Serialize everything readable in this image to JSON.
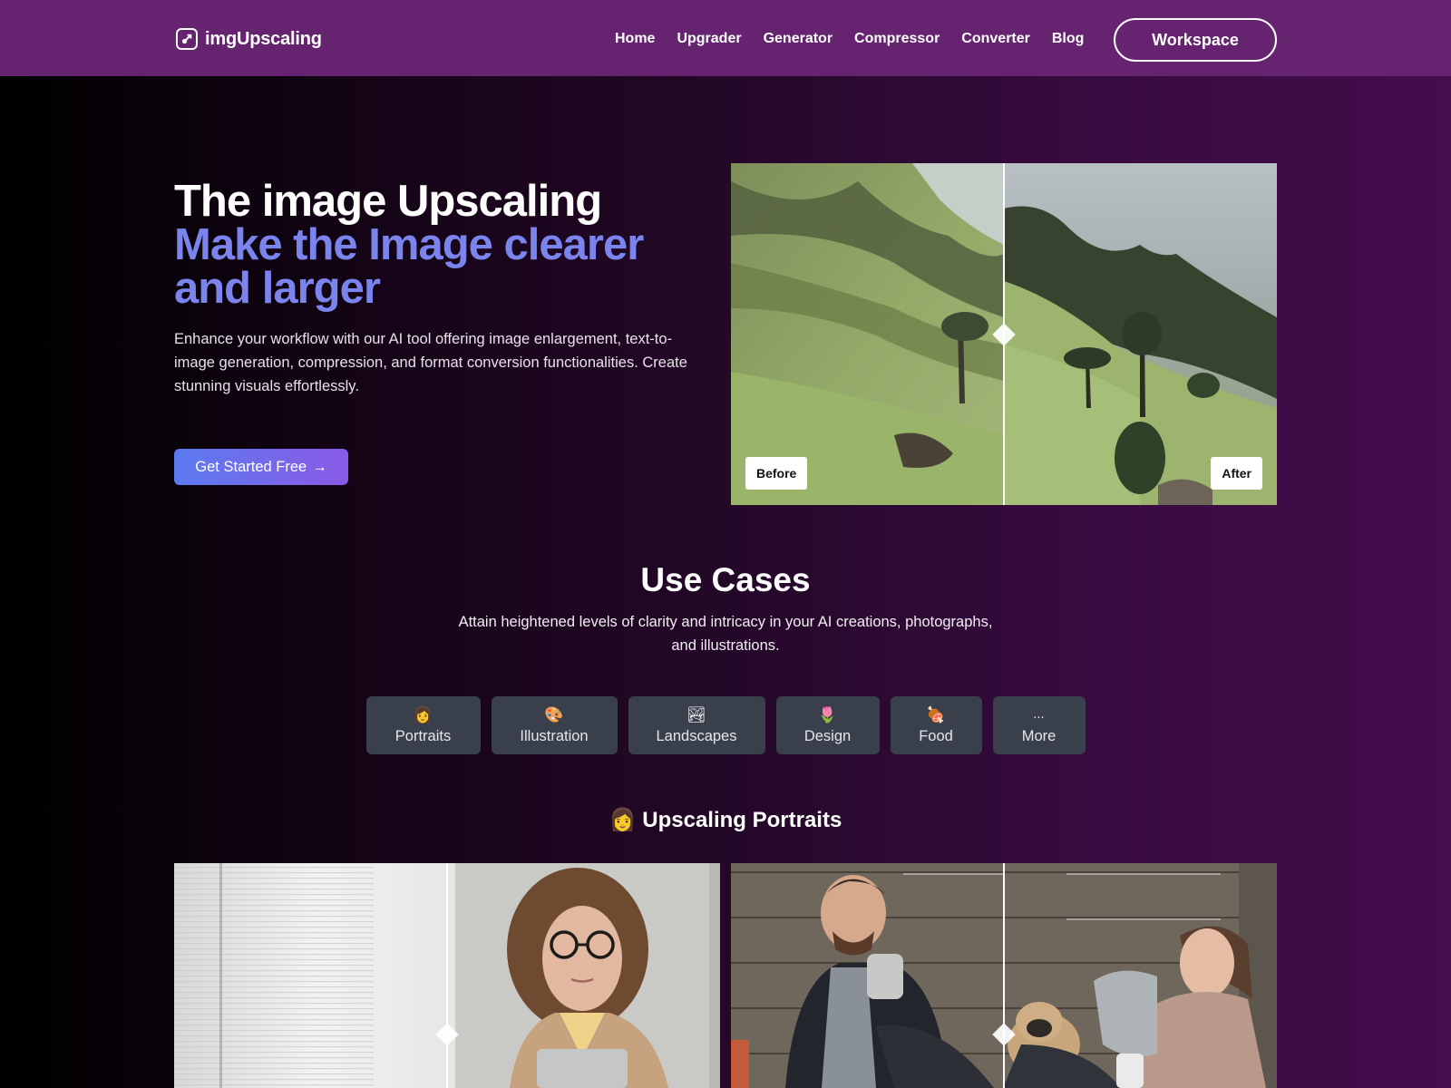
{
  "navbar": {
    "brand": "imgUpscaling",
    "brand_icon": "expand-arrow-icon",
    "links": [
      "Home",
      "Upgrader",
      "Generator",
      "Compressor",
      "Converter",
      "Blog"
    ],
    "workspace_label": "Workspace",
    "background_color": "#652370"
  },
  "hero": {
    "title_white": "The image Upscaling ",
    "title_accent": "Make the Image clearer and larger",
    "accent_color": "#7b84ec",
    "description": "Enhance your workflow with our AI tool offering image enlargement, text-to-image generation, compression, and format conversion functionalities. Create stunning visuals effortlessly.",
    "cta_label": "Get Started Free",
    "cta_arrow": "→",
    "comparison": {
      "subject": "green mountain hillside landscape",
      "before_label": "Before",
      "after_label": "After",
      "split": 0.5
    }
  },
  "use_cases": {
    "title": "Use Cases",
    "description": "Attain heightened levels of clarity and intricacy in your AI creations, photographs, and illustrations.",
    "categories": [
      {
        "emoji": "👩",
        "icon": "woman-icon",
        "label": "Portraits"
      },
      {
        "emoji": "🎨",
        "icon": "palette-icon",
        "label": "Illustration"
      },
      {
        "emoji": "🏞",
        "icon": "landscape-picture-icon",
        "label": "Landscapes"
      },
      {
        "emoji": "🌷",
        "icon": "tulip-icon",
        "label": "Design"
      },
      {
        "emoji": "🍖",
        "icon": "meat-icon",
        "label": "Food"
      },
      {
        "emoji": "...",
        "icon": "ellipsis-icon",
        "label": "More"
      }
    ]
  },
  "portraits": {
    "emoji": "👩",
    "title": "Upscaling Portraits",
    "examples": [
      {
        "subject": "woman with glasses holding laptop by window blinds",
        "split": 0.5
      },
      {
        "subject": "couple with pug sitting against wooden wall",
        "split": 0.5
      }
    ]
  }
}
